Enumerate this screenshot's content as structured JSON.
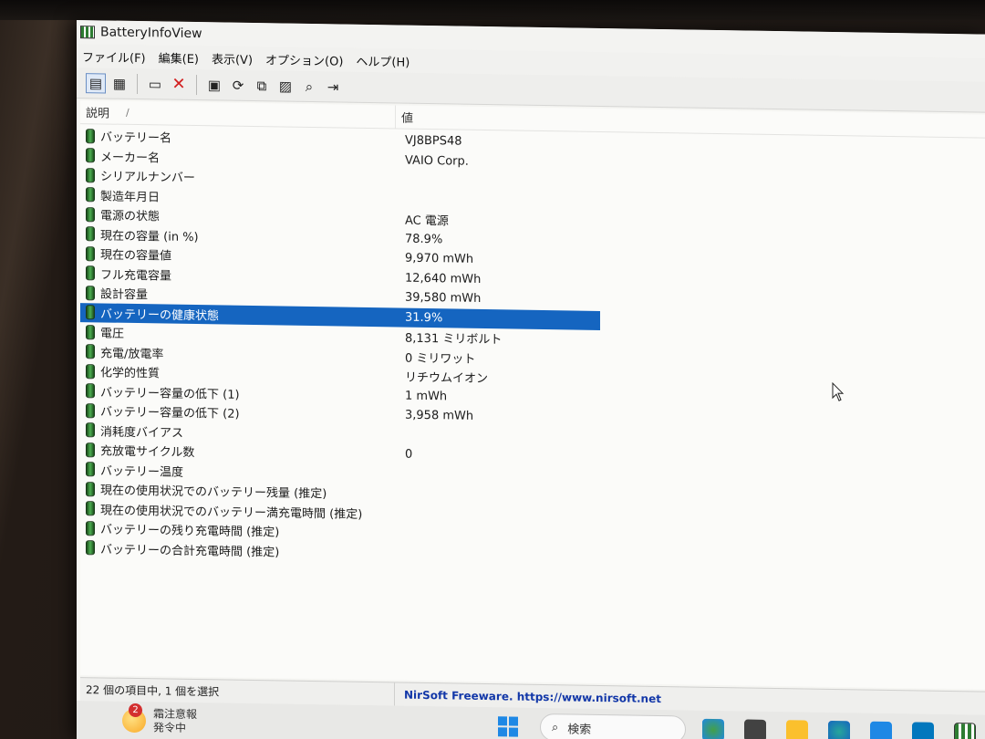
{
  "window": {
    "title": "BatteryInfoView"
  },
  "menu": [
    "ファイル(F)",
    "編集(E)",
    "表示(V)",
    "オプション(O)",
    "ヘルプ(H)"
  ],
  "toolbar": [
    {
      "name": "view-vertical-icon",
      "glyph": "▤"
    },
    {
      "name": "view-log-icon",
      "glyph": "▦"
    },
    {
      "name": "properties-icon",
      "glyph": "▭"
    },
    {
      "name": "delete-icon",
      "glyph": "✕"
    },
    {
      "name": "save-icon",
      "glyph": "▣"
    },
    {
      "name": "refresh-icon",
      "glyph": "⟳"
    },
    {
      "name": "copy-icon",
      "glyph": "⧉"
    },
    {
      "name": "html-report-icon",
      "glyph": "▨"
    },
    {
      "name": "find-icon",
      "glyph": "⌕"
    },
    {
      "name": "exit-icon",
      "glyph": "⇥"
    }
  ],
  "columns": {
    "desc": "説明",
    "sort_indicator": "/",
    "val": "値"
  },
  "rows": [
    {
      "desc": "バッテリー名",
      "val": "VJ8BPS48"
    },
    {
      "desc": "メーカー名",
      "val": "VAIO Corp."
    },
    {
      "desc": "シリアルナンバー",
      "val": ""
    },
    {
      "desc": "製造年月日",
      "val": ""
    },
    {
      "desc": "電源の状態",
      "val": "AC 電源"
    },
    {
      "desc": "現在の容量 (in %)",
      "val": "78.9%"
    },
    {
      "desc": "現在の容量値",
      "val": "9,970 mWh"
    },
    {
      "desc": "フル充電容量",
      "val": "12,640 mWh"
    },
    {
      "desc": "設計容量",
      "val": "39,580 mWh"
    },
    {
      "desc": "バッテリーの健康状態",
      "val": "31.9%",
      "selected": true
    },
    {
      "desc": "電圧",
      "val": "8,131 ミリボルト"
    },
    {
      "desc": "充電/放電率",
      "val": "0 ミリワット"
    },
    {
      "desc": "化学的性質",
      "val": "リチウムイオン"
    },
    {
      "desc": "バッテリー容量の低下 (1)",
      "val": "1 mWh"
    },
    {
      "desc": "バッテリー容量の低下 (2)",
      "val": "3,958 mWh"
    },
    {
      "desc": "消耗度バイアス",
      "val": ""
    },
    {
      "desc": "充放電サイクル数",
      "val": "0"
    },
    {
      "desc": "バッテリー温度",
      "val": ""
    },
    {
      "desc": "現在の使用状況でのバッテリー残量 (推定)",
      "val": ""
    },
    {
      "desc": "現在の使用状況でのバッテリー満充電時間 (推定)",
      "val": ""
    },
    {
      "desc": "バッテリーの残り充電時間 (推定)",
      "val": ""
    },
    {
      "desc": "バッテリーの合計充電時間 (推定)",
      "val": ""
    }
  ],
  "status": {
    "left": "22 個の項目中, 1 個を選択",
    "right": "NirSoft Freeware. https://www.nirsoft.net"
  },
  "taskbar": {
    "weather_badge": "2",
    "weather_line1": "霜注意報",
    "weather_line2": "発令中",
    "search_placeholder": "検索"
  },
  "colors": {
    "selection": "#1565c0",
    "battery_icon": "#4caf50",
    "link": "#1237a8"
  }
}
